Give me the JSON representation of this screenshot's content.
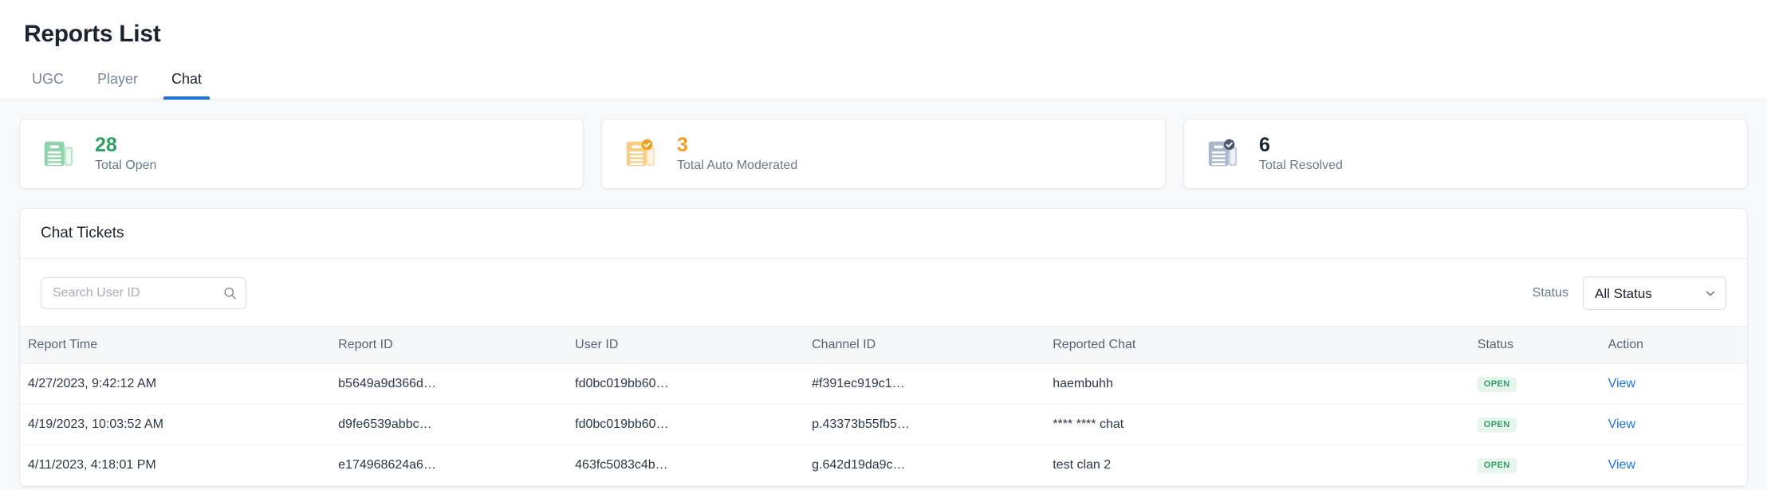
{
  "header": {
    "title": "Reports List",
    "tabs": [
      {
        "label": "UGC",
        "active": false
      },
      {
        "label": "Player",
        "active": false
      },
      {
        "label": "Chat",
        "active": true
      }
    ],
    "active_tab_accent": "#1a73e8"
  },
  "stats": [
    {
      "value": "28",
      "label": "Total Open",
      "icon": "document-lines-icon",
      "color": "#2f9e63",
      "tone": "green"
    },
    {
      "value": "3",
      "label": "Total Auto Moderated",
      "icon": "document-check-badge-icon",
      "color": "#f0a020",
      "tone": "orange"
    },
    {
      "value": "6",
      "label": "Total Resolved",
      "icon": "document-check-badge-icon",
      "color": "#1b2431",
      "tone": "dark"
    }
  ],
  "panel": {
    "title": "Chat Tickets",
    "search": {
      "placeholder": "Search User ID",
      "value": "",
      "icon": "search-icon"
    },
    "filter": {
      "label": "Status",
      "selected": "All Status",
      "chevron_icon": "chevron-down-icon",
      "options": [
        "All Status"
      ]
    },
    "table": {
      "columns": [
        "Report Time",
        "Report ID",
        "User ID",
        "Channel ID",
        "Reported Chat",
        "Status",
        "Action"
      ],
      "rows": [
        {
          "report_time": "4/27/2023, 9:42:12 AM",
          "report_id": "b5649a9d366d…",
          "user_id": "fd0bc019bb60…",
          "channel_id": "#f391ec919c1…",
          "reported_chat": "haembuhh",
          "status": "OPEN",
          "action": "View"
        },
        {
          "report_time": "4/19/2023, 10:03:52 AM",
          "report_id": "d9fe6539abbc…",
          "user_id": "fd0bc019bb60…",
          "channel_id": "p.43373b55fb5…",
          "reported_chat": "**** **** chat",
          "status": "OPEN",
          "action": "View"
        },
        {
          "report_time": "4/11/2023, 4:18:01 PM",
          "report_id": "e174968624a6…",
          "user_id": "463fc5083c4b…",
          "channel_id": "g.642d19da9c…",
          "reported_chat": "test clan 2",
          "status": "OPEN",
          "action": "View"
        }
      ],
      "status_badge_color": "#2f9e63",
      "status_badge_bg": "#e7f6ec",
      "action_link_color": "#1a73e8"
    }
  }
}
